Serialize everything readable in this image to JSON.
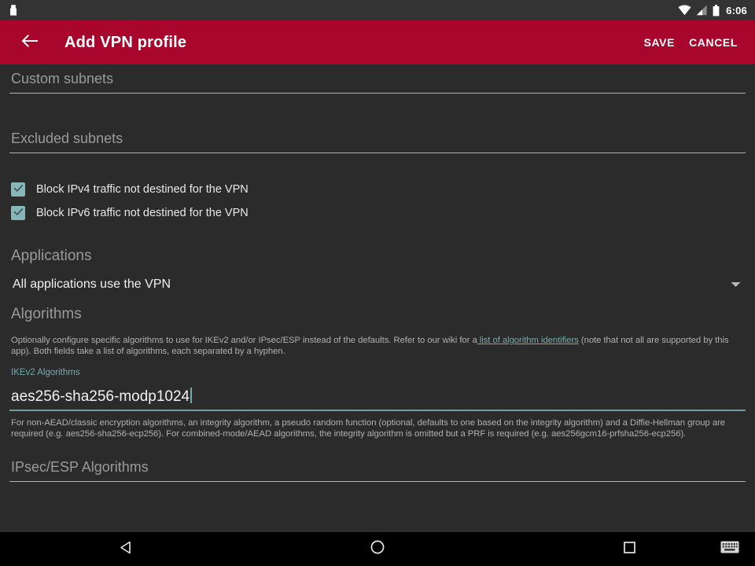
{
  "status_bar": {
    "notification_icon": "vpn-key-icon",
    "wifi_icon": "wifi-icon",
    "signal_icon": "cellular-signal-icon",
    "battery_icon": "battery-icon",
    "time": "6:06"
  },
  "app_bar": {
    "back_icon": "back-arrow-icon",
    "title": "Add VPN profile",
    "save_label": "SAVE",
    "cancel_label": "CANCEL",
    "background_color": "#a8062c"
  },
  "form": {
    "custom_subnets": {
      "placeholder": "Custom subnets",
      "value": ""
    },
    "excluded_subnets": {
      "placeholder": "Excluded subnets",
      "value": ""
    },
    "block_ipv4": {
      "label": "Block IPv4 traffic not destined for the VPN",
      "checked": true,
      "check_icon": "checkmark-icon"
    },
    "block_ipv6": {
      "label": "Block IPv6 traffic not destined for the VPN",
      "checked": true,
      "check_icon": "checkmark-icon"
    },
    "applications": {
      "title": "Applications",
      "selected": "All applications use the VPN",
      "dropdown_icon": "chevron-down-icon"
    },
    "algorithms": {
      "title": "Algorithms",
      "description_before_link": "Optionally configure specific algorithms to use for IKEv2 and/or IPsec/ESP instead of the defaults. Refer to our wiki for a",
      "description_link": " list of algorithm identifiers",
      "description_after_link": " (note that not all are supported by this app). Both fields take a list of algorithms, each separated by a hyphen.",
      "ikev2": {
        "label": "IKEv2 Algorithms",
        "value": "aes256-sha256-modp1024",
        "focused": true,
        "helper": "For non-AEAD/classic encryption algorithms, an integrity algorithm, a pseudo random function (optional, defaults to one based on the integrity algorithm) and a Diffie-Hellman group are required (e.g. aes256-sha256-ecp256). For combined-mode/AEAD algorithms, the integrity algorithm is omitted but a PRF is required (e.g. aes256gcm16-prfsha256-ecp256)."
      },
      "ipsec_esp": {
        "placeholder": "IPsec/ESP Algorithms",
        "value": ""
      }
    }
  },
  "nav_bar": {
    "back_icon": "nav-back-triangle-icon",
    "home_icon": "nav-home-circle-icon",
    "recents_icon": "nav-recents-square-icon",
    "ime_icon": "keyboard-icon"
  },
  "colors": {
    "accent_teal": "#79aaab",
    "app_bar_crimson": "#a8062c",
    "background": "#2b2b2b"
  }
}
